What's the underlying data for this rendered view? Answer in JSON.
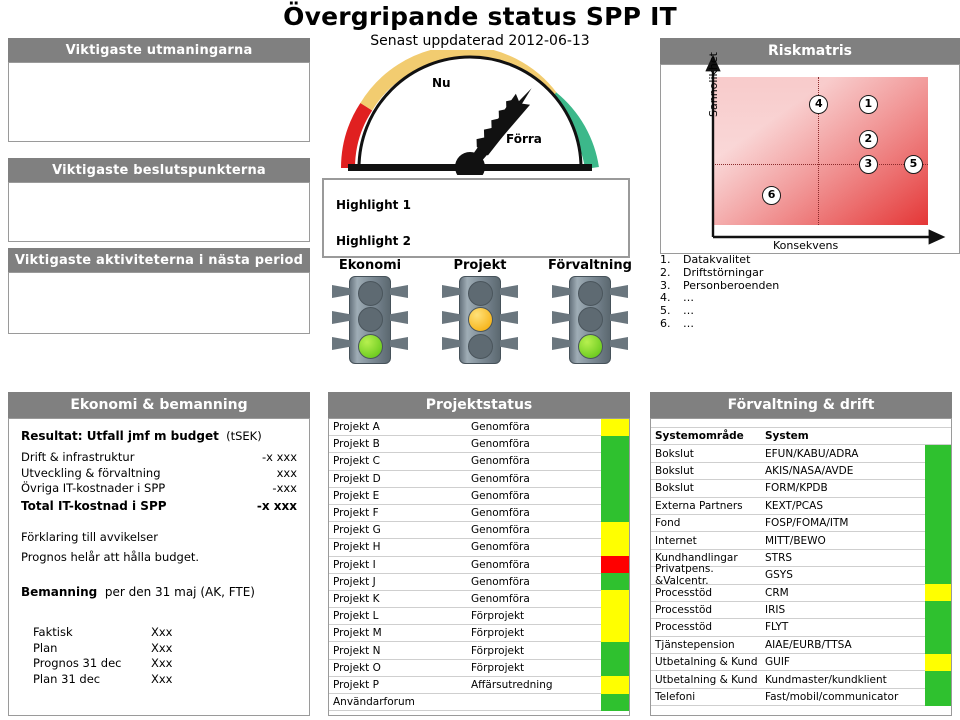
{
  "title": "Övergripande status SPP IT",
  "subtitle": "Senast uppdaterad 2012-06-13",
  "left_boxes": [
    {
      "heading": "Viktigaste utmaningarna",
      "content": ""
    },
    {
      "heading": "Viktigaste beslutspunkterna",
      "content": ""
    },
    {
      "heading": "Viktigaste aktiviteterna i nästa period",
      "content": ""
    }
  ],
  "gauge": {
    "label_now": "Nu",
    "label_prev": "Förra",
    "colors": {
      "red": "#e02020",
      "yellow": "#f2cc70",
      "green": "#3cb88a"
    },
    "needle_angle_deg": 52
  },
  "highlights": [
    "Highlight 1",
    "Highlight 2"
  ],
  "traffic_lights": [
    {
      "label": "Ekonomi",
      "state": "green"
    },
    {
      "label": "Projekt",
      "state": "yellow"
    },
    {
      "label": "Förvaltning",
      "state": "green"
    }
  ],
  "risk_matrix": {
    "heading": "Riskmatris",
    "y_axis": "Sannolikhet",
    "x_axis": "Konsekvens",
    "points": [
      {
        "id": "1",
        "x": 72,
        "y": 82
      },
      {
        "id": "2",
        "x": 72,
        "y": 58
      },
      {
        "id": "3",
        "x": 72,
        "y": 41
      },
      {
        "id": "4",
        "x": 49,
        "y": 82
      },
      {
        "id": "5",
        "x": 93,
        "y": 41
      },
      {
        "id": "6",
        "x": 27,
        "y": 20
      }
    ],
    "legend": [
      {
        "num": "1.",
        "text": "Datakvalitet"
      },
      {
        "num": "2.",
        "text": "Driftstörningar"
      },
      {
        "num": "3.",
        "text": "Personberoenden"
      },
      {
        "num": "4.",
        "text": "…"
      },
      {
        "num": "5.",
        "text": "…"
      },
      {
        "num": "6.",
        "text": "…"
      }
    ]
  },
  "economy": {
    "heading": "Ekonomi & bemanning",
    "result_title": "Resultat: Utfall jmf m budget",
    "result_unit": "(tSEK)",
    "rows": [
      {
        "label": "Drift & infrastruktur",
        "value": "-x xxx",
        "bold": false
      },
      {
        "label": "Utveckling & förvaltning",
        "value": "xxx",
        "bold": false
      },
      {
        "label": "Övriga IT-kostnader i SPP",
        "value": "-xxx",
        "bold": false
      },
      {
        "label": "Total IT-kostnad i SPP",
        "value": "-x xxx",
        "bold": true
      }
    ],
    "deviation_title": "Förklaring till avvikelser",
    "deviation_text": "Prognos helår att hålla budget.",
    "staffing_title": "Bemanning",
    "staffing_subtitle": "per den 31 maj (AK, FTE)",
    "staffing_rows": [
      {
        "label": "Faktisk",
        "value": "Xxx"
      },
      {
        "label": "Plan",
        "value": "Xxx"
      },
      {
        "label": "Prognos 31 dec",
        "value": "Xxx"
      },
      {
        "label": "Plan 31 dec",
        "value": "Xxx"
      }
    ]
  },
  "projects": {
    "heading": "Projektstatus",
    "rows": [
      {
        "name": "Projekt A",
        "phase": "Genomföra",
        "status": "yellow"
      },
      {
        "name": "Projekt B",
        "phase": "Genomföra",
        "status": "green"
      },
      {
        "name": "Projekt C",
        "phase": "Genomföra",
        "status": "green"
      },
      {
        "name": "Projekt D",
        "phase": "Genomföra",
        "status": "green"
      },
      {
        "name": "Projekt E",
        "phase": "Genomföra",
        "status": "green"
      },
      {
        "name": "Projekt F",
        "phase": "Genomföra",
        "status": "green"
      },
      {
        "name": "Projekt G",
        "phase": "Genomföra",
        "status": "yellow"
      },
      {
        "name": "Projekt H",
        "phase": "Genomföra",
        "status": "yellow"
      },
      {
        "name": "Projekt I",
        "phase": "Genomföra",
        "status": "red"
      },
      {
        "name": "Projekt J",
        "phase": "Genomföra",
        "status": "green"
      },
      {
        "name": "Projekt K",
        "phase": "Genomföra",
        "status": "yellow"
      },
      {
        "name": "Projekt L",
        "phase": "Förprojekt",
        "status": "yellow"
      },
      {
        "name": "Projekt M",
        "phase": "Förprojekt",
        "status": "yellow"
      },
      {
        "name": "Projekt N",
        "phase": "Förprojekt",
        "status": "green"
      },
      {
        "name": "Projekt O",
        "phase": "Förprojekt",
        "status": "green"
      },
      {
        "name": "Projekt P",
        "phase": "Affärsutredning",
        "status": "yellow"
      },
      {
        "name": "Användarforum",
        "phase": "",
        "status": "green"
      }
    ]
  },
  "management": {
    "heading": "Förvaltning & drift",
    "columns": {
      "area": "Systemområde",
      "system": "System"
    },
    "rows": [
      {
        "area": "Bokslut",
        "system": "EFUN/KABU/ADRA",
        "status": "green"
      },
      {
        "area": "Bokslut",
        "system": "AKIS/NASA/AVDE",
        "status": "green"
      },
      {
        "area": "Bokslut",
        "system": "FORM/KPDB",
        "status": "green"
      },
      {
        "area": "Externa Partners",
        "system": "KEXT/PCAS",
        "status": "green"
      },
      {
        "area": "Fond",
        "system": "FOSP/FOMA/ITM",
        "status": "green"
      },
      {
        "area": "Internet",
        "system": "MITT/BEWO",
        "status": "green"
      },
      {
        "area": "Kundhandlingar",
        "system": "STRS",
        "status": "green"
      },
      {
        "area": "Privatpens. &Valcentr.",
        "system": "GSYS",
        "status": "green"
      },
      {
        "area": "Processtöd",
        "system": "CRM",
        "status": "yellow"
      },
      {
        "area": "Processtöd",
        "system": "IRIS",
        "status": "green"
      },
      {
        "area": "Processtöd",
        "system": "FLYT",
        "status": "green"
      },
      {
        "area": "Tjänstepension",
        "system": "AIAE/EURB/TTSA",
        "status": "green"
      },
      {
        "area": "Utbetalning & Kund",
        "system": "GUIF",
        "status": "yellow"
      },
      {
        "area": "Utbetalning & Kund",
        "system": "Kundmaster/kundklient",
        "status": "green"
      },
      {
        "area": "Telefoni",
        "system": "Fast/mobil/communicator",
        "status": "green"
      }
    ]
  },
  "palette": {
    "header_gray": "#808080",
    "green": "#2fc12f",
    "yellow": "#ffff00",
    "red": "#ff0000"
  }
}
